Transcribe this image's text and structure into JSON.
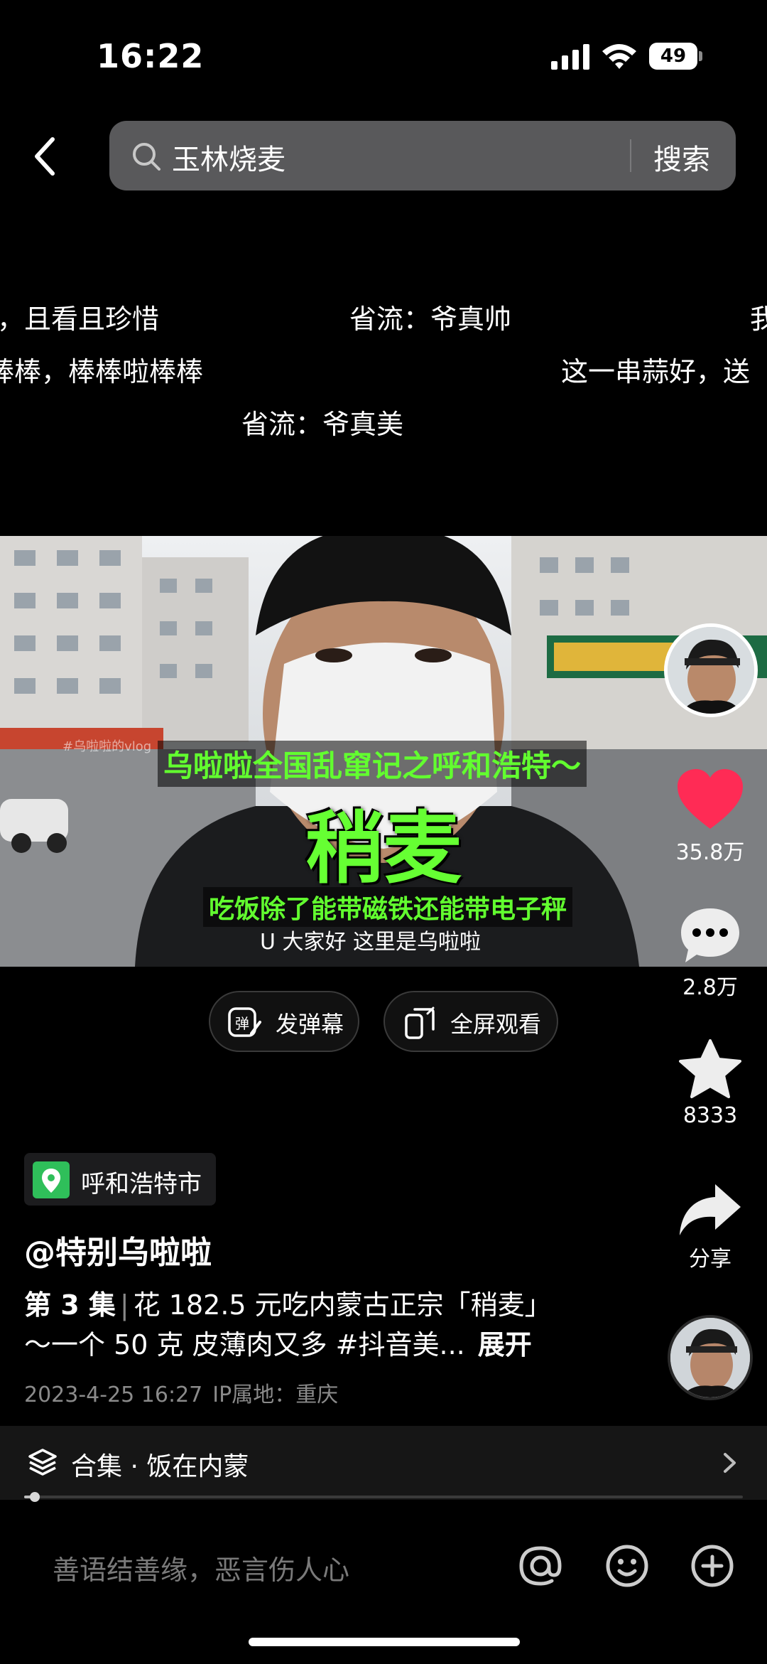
{
  "status_bar": {
    "time": "16:22",
    "battery": "49"
  },
  "search": {
    "query": "玉林烧麦",
    "button_label": "搜索"
  },
  "danmaku": [
    "，且看且珍惜",
    "省流：爷真帅",
    "我",
    "棒棒，棒棒啦棒棒",
    "这一串蒜好，送",
    "省流：爷真美"
  ],
  "video": {
    "caption_top": "乌啦啦全国乱窜记之呼和浩特～",
    "caption_main": "稍麦",
    "caption_sub": "吃饭除了能带磁铁还能带电子秤",
    "subtitle": "U 大家好 这里是乌啦啦",
    "watermark": "#乌啦啦的vlog"
  },
  "actions": {
    "danmaku_label": "发弹幕",
    "fullscreen_label": "全屏观看"
  },
  "rail": {
    "likes": "35.8万",
    "comments": "2.8万",
    "favorites": "8333",
    "share": "分享",
    "like_color": "#ff2b55"
  },
  "post": {
    "location": "呼和浩特市",
    "author": "@特别乌啦啦",
    "episode": "第 3 集",
    "description_line1": "花 182.5 元吃内蒙古正宗「稍麦」",
    "description_line2": "～一个 50 克 皮薄肉又多 #抖音美...",
    "expand_label": "展开",
    "date": "2023-4-25 16:27",
    "ip_location": "IP属地：重庆"
  },
  "collection": {
    "label": "合集 · 饭在内蒙",
    "progress": 0.01
  },
  "comment_bar": {
    "placeholder": "善语结善缘，恶言伤人心"
  },
  "icons": [
    "back-icon",
    "search-icon",
    "danmaku-icon",
    "fullscreen-icon",
    "heart-icon",
    "comment-icon",
    "star-icon",
    "share-icon",
    "collection-icon",
    "chevron-right-icon",
    "at-icon",
    "emoji-icon",
    "plus-icon",
    "location-pin-icon"
  ]
}
